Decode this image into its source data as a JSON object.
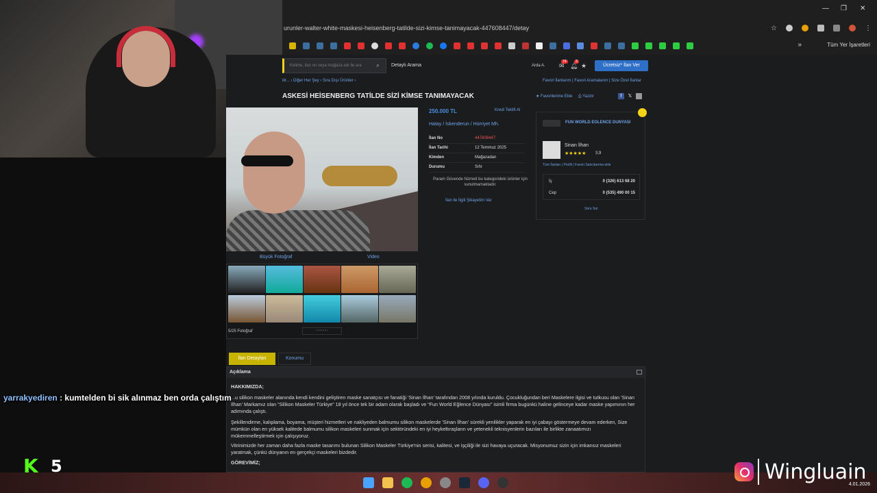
{
  "browser": {
    "url": "urunler-walter-white-maskesi-heisenberg-tatilde-sizi-kimse-tanimayacak-447608447/detay",
    "bookmarks_all": "Tüm Yer İşaretleri"
  },
  "site": {
    "search_placeholder": "Kelime, ilan no veya mağaza adı ile ara",
    "detail_search": "Detaylı Arama",
    "user": "Arda A.",
    "notif_count": "74",
    "msg_count": "3",
    "post_ad": "Ücretsiz* İlan Ver",
    "breadcrumb": "ilir... › Diğer Her Şey › Sıra Dışı Ürünler ›",
    "fav_links": "Favori İlanlarım  |  Favori Aramalarım  |  Size Özel İlanlar",
    "title": "ASKESİ HEİSENBERG TATİLDE SİZİ KİMSE TANIMAYACAK",
    "add_fav": "★ Favorilerime Ekle",
    "print": "Yazdır",
    "big_photo": "Büyük Fotoğraf",
    "video": "Video",
    "photo_count": "5/25 Fotoğraf",
    "price": "250.000 TL",
    "credit": "Kredi Teklifi Al",
    "location": "Hatay  /  İskenderun  /  Hürriyet Mh.",
    "details": [
      {
        "k": "İlan No",
        "v": "447608447"
      },
      {
        "k": "İlan Tarihi",
        "v": "12 Temmuz 2025"
      },
      {
        "k": "Kimden",
        "v": "Mağazadan"
      },
      {
        "k": "Durumu",
        "v": "Sıfır"
      }
    ],
    "safe_note": "Param Güvende hizmeti bu kategorideki ürünler için sunulmamaktadır.",
    "complaint": "İlan ile İlgili Şikayetim Var",
    "seller": {
      "store": "FUN WORLD EGLENCE DUNYASI",
      "name": "Sinan İlhan",
      "rating": "3,9",
      "links": "Tüm İlanları  |  Profili  |  Favori Satıcılarıma ekle",
      "phones": [
        {
          "label": "İş",
          "number": "0 (326) 613 68 20"
        },
        {
          "label": "Cep",
          "number": "0 (535) 490 00 15"
        }
      ],
      "ask": "Soru Sor"
    },
    "tabs": [
      "İlan Detayları",
      "Konumu"
    ],
    "description": {
      "header": "Açıklama",
      "p0": "HAKKIMIZDA;",
      "p1": "...u silikon maskeler alanında kendi kendini geliştiren maske sanatçısı ve fanatiği 'Sinan İlhan' tarafından 2008 yılında kuruldu. Çocukluğundan beri Maskelere ilgisi ve tutkusu olan 'Sinan İlhan' Markamız olan “Silikon Maskeler Türkiye” 18 yıl önce tek bir adam olarak başladı ve “Fun World Eğlence Dünyası” isimli firma bugünkü haline gelinceye kadar maske yapımının her adımında çalıştı.",
      "p2": "Şekillendirme, kalıplama, boyama, müşteri hizmetleri ve nakliyeden balmumu silikon maskelerde 'Sinan İlhan' sürekli yenilikler yaparak en iyi çabayı göstermeye devam ederken, Size mümkün olan en yüksek kalitede balmumu silikon maskeleri sunmak için sektöründeki en iyi heykeltıraşların ve yetenekli teknisyenlerin bazıları ile birlikte zanaatımızı mükemmelleştirmek için çalışıyoruz.",
      "p3": "Vitrinimizde her zaman daha fazla maske tasarımı bulunan Silikon Maskeler Türkiye'nin serisi, kalitesi, ve işçiliği ile sizi havaya uçuracak. Misyonumuz sizin için imkansız maskeleri yaratmak, çünkü dünyanın en gerçekçi maskeleri bizdedir.",
      "p4": "GÖREVİMİZ;"
    }
  },
  "overlay": {
    "chat_user": "yarrakyediren",
    "chat_msg": " : kumtelden bi sik alınmaz ben orda çalıştım",
    "kick_logo": "K",
    "kick_count": "5",
    "brand": "Wingluain"
  },
  "taskbar": {
    "clock_date": "4.01.2026"
  },
  "colors": {
    "accent": "#f5d418",
    "link": "#6fa3e8",
    "button": "#2e6fc7"
  }
}
